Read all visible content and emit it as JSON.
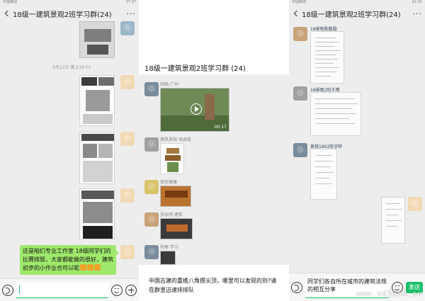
{
  "left": {
    "status_left": "中国移动",
    "status_time": "17:37",
    "title": "18级一建筑景观2班学习群(24)",
    "timestamp": "3月13日 晚上19:01",
    "my_message": "这是咱们专业工作室 18级同学们的比赛排版，大家都能做的很好，建筑初步的小作业也可以呢"
  },
  "middle": {
    "title": "18级一建筑景观2班学习群 (24)",
    "senders": [
      "网络-广州",
      "建筑景观 戏曲楼",
      "微信健康",
      "张永明 建筑",
      "杨春 学习"
    ],
    "video_duration": "00:17",
    "caption": "中国古建的重檐八角攒尖顶，哪里可以发现的到?请在群里迅速排排队"
  },
  "right": {
    "status_left": "中国移动",
    "status_time": "21:33",
    "title": "18级一建筑景观2班学习群(24)",
    "senders": [
      "18景观陈懿璇",
      "18景观2班王晴",
      "景观1802陈宇轩"
    ],
    "input_value": "同学们各自所在城市的建筑法规的相互分享",
    "send_label": "发送"
  },
  "watermark": "www.sd1954.cn",
  "colors": {
    "wechat_green": "#19c06a",
    "bubble_green": "#9fe86b"
  }
}
